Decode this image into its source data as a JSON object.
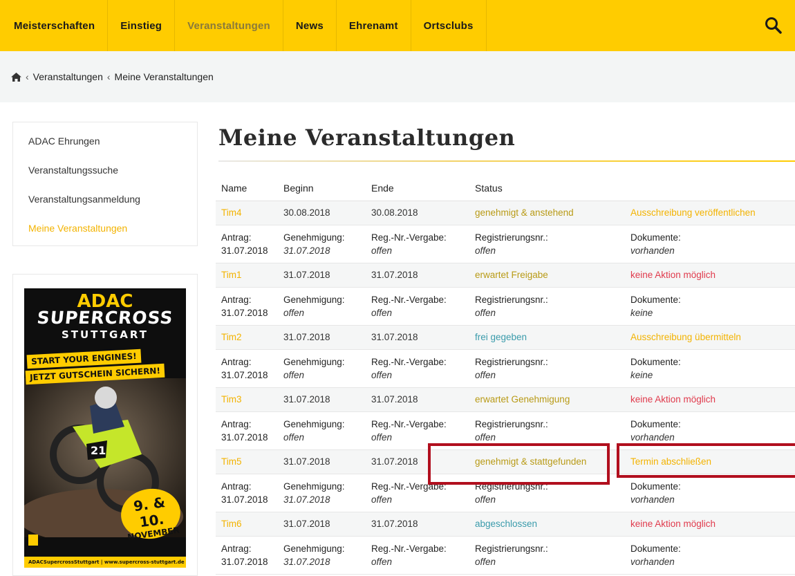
{
  "nav": {
    "items": [
      "Meisterschaften",
      "Einstieg",
      "Veranstaltungen",
      "News",
      "Ehrenamt",
      "Ortsclubs"
    ],
    "active_index": 2,
    "search_icon": "search-icon"
  },
  "breadcrumb": {
    "home_icon": "home-icon",
    "items": [
      "Veranstaltungen",
      "Meine Veranstaltungen"
    ]
  },
  "sidebar": {
    "items": [
      "ADAC Ehrungen",
      "Veranstaltungssuche",
      "Veranstaltungsanmeldung",
      "Meine Veranstaltungen"
    ],
    "active_index": 3
  },
  "ad": {
    "brand": "ADAC",
    "title": "SUPERCROSS",
    "city": "STUTTGART",
    "line1": "START YOUR ENGINES!",
    "line2": "JETZT GUTSCHEIN SICHERN!",
    "date_line1": "9. & 10.",
    "date_line2": "NOVEMBER",
    "footer": "ADACSupercrossStuttgart | www.supercross-stuttgart.de"
  },
  "page": {
    "title": "Meine Veranstaltungen"
  },
  "table": {
    "headers": [
      "Name",
      "Beginn",
      "Ende",
      "Status",
      ""
    ],
    "labels": {
      "antrag": "Antrag:",
      "genehmigung": "Genehmigung:",
      "regvergabe": "Reg.-Nr.-Vergabe:",
      "regnr": "Registrierungsnr.:",
      "dokumente": "Dokumente:"
    },
    "rows": [
      {
        "name": "Tim4",
        "beginn": "30.08.2018",
        "ende": "30.08.2018",
        "status": "genehmigt & anstehend",
        "action": "Ausschreibung veröffentlichen",
        "antrag": "31.07.2018",
        "genehmigung": "31.07.2018",
        "regvergabe": "offen",
        "regnr": "offen",
        "dokumente": "vorhanden"
      },
      {
        "name": "Tim1",
        "beginn": "31.07.2018",
        "ende": "31.07.2018",
        "status": "erwartet Freigabe",
        "action": "keine Aktion möglich",
        "antrag": "31.07.2018",
        "genehmigung": "offen",
        "regvergabe": "offen",
        "regnr": "offen",
        "dokumente": "keine"
      },
      {
        "name": "Tim2",
        "beginn": "31.07.2018",
        "ende": "31.07.2018",
        "status": "frei gegeben",
        "action": "Ausschreibung übermitteln",
        "antrag": "31.07.2018",
        "genehmigung": "offen",
        "regvergabe": "offen",
        "regnr": "offen",
        "dokumente": "keine"
      },
      {
        "name": "Tim3",
        "beginn": "31.07.2018",
        "ende": "31.07.2018",
        "status": "erwartet Genehmigung",
        "action": "keine Aktion möglich",
        "antrag": "31.07.2018",
        "genehmigung": "offen",
        "regvergabe": "offen",
        "regnr": "offen",
        "dokumente": "vorhanden"
      },
      {
        "name": "Tim5",
        "beginn": "31.07.2018",
        "ende": "31.07.2018",
        "status": "genehmigt & stattgefunden",
        "action": "Termin abschließen",
        "antrag": "31.07.2018",
        "genehmigung": "31.07.2018",
        "regvergabe": "offen",
        "regnr": "offen",
        "dokumente": "vorhanden"
      },
      {
        "name": "Tim6",
        "beginn": "31.07.2018",
        "ende": "31.07.2018",
        "status": "abgeschlossen",
        "action": "keine Aktion möglich",
        "antrag": "31.07.2018",
        "genehmigung": "31.07.2018",
        "regvergabe": "offen",
        "regnr": "offen",
        "dokumente": "vorhanden"
      }
    ]
  },
  "colors": {
    "nav_bg": "#ffcc00",
    "accent_yellow": "#f3b300",
    "status_olive": "#b89a15",
    "status_teal": "#3a9bab",
    "action_red": "#e03a4c",
    "highlight_box": "#b10f1e"
  }
}
